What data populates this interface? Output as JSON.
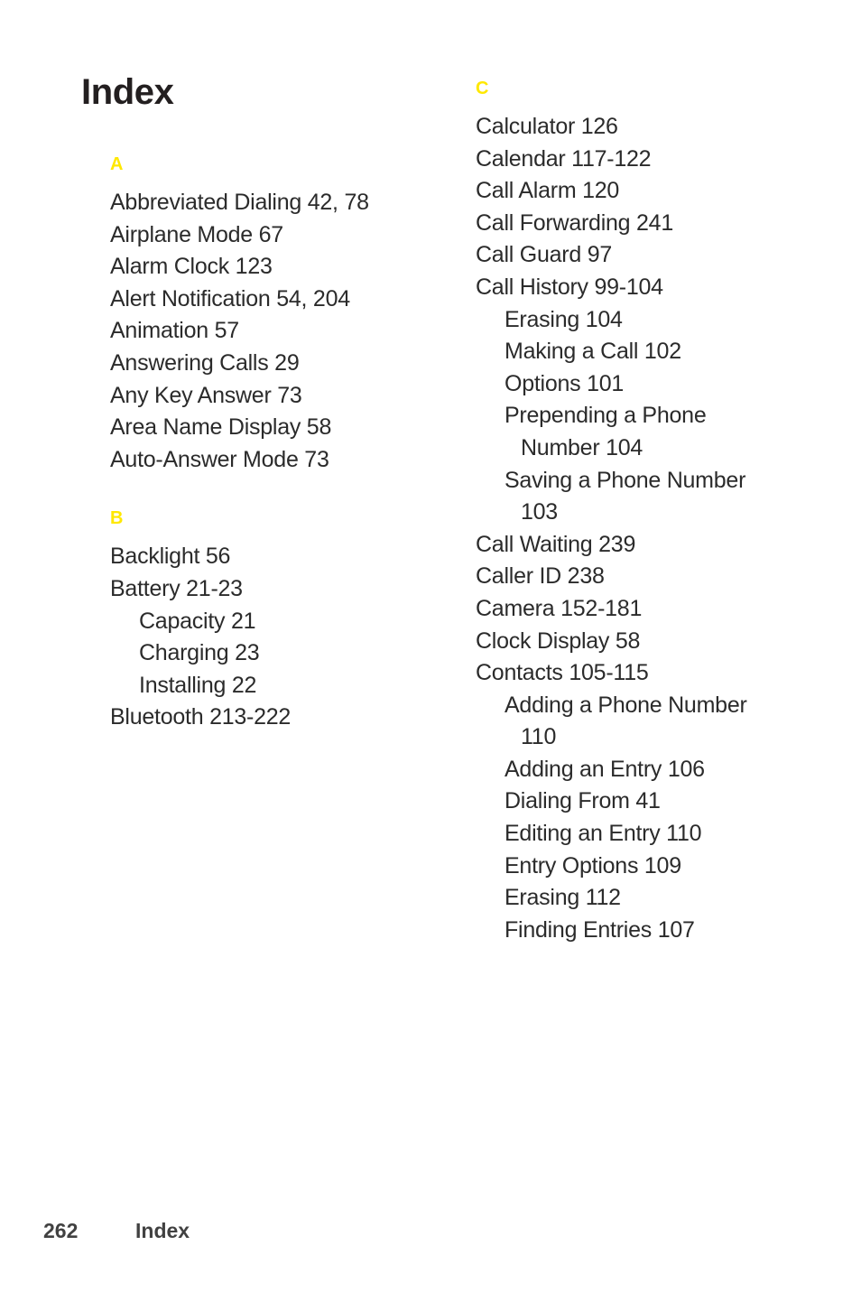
{
  "page": {
    "title": "Index",
    "background_color": "#ffffff",
    "letter_heading_color": "#ffe800",
    "body_text_color": "#2b2b2b",
    "title_color": "#231f20"
  },
  "columns": {
    "left": {
      "sections": [
        {
          "letter": "A",
          "entries": [
            {
              "text": "Abbreviated Dialing 42, 78",
              "level": "main"
            },
            {
              "text": "Airplane Mode 67",
              "level": "main"
            },
            {
              "text": "Alarm Clock 123",
              "level": "main"
            },
            {
              "text": "Alert Notification 54, 204",
              "level": "main"
            },
            {
              "text": "Animation 57",
              "level": "main"
            },
            {
              "text": "Answering Calls 29",
              "level": "main"
            },
            {
              "text": "Any Key Answer 73",
              "level": "main"
            },
            {
              "text": "Area Name Display 58",
              "level": "main"
            },
            {
              "text": "Auto-Answer Mode 73",
              "level": "main"
            }
          ]
        },
        {
          "letter": "B",
          "entries": [
            {
              "text": "Backlight 56",
              "level": "main"
            },
            {
              "text": "Battery 21-23",
              "level": "main"
            },
            {
              "text": "Capacity 21",
              "level": "sub"
            },
            {
              "text": "Charging 23",
              "level": "sub"
            },
            {
              "text": "Installing 22",
              "level": "sub"
            },
            {
              "text": "Bluetooth 213-222",
              "level": "main"
            }
          ]
        }
      ]
    },
    "right": {
      "sections": [
        {
          "letter": "C",
          "entries": [
            {
              "text": "Calculator 126",
              "level": "main"
            },
            {
              "text": "Calendar 117-122",
              "level": "main"
            },
            {
              "text": "Call Alarm 120",
              "level": "main"
            },
            {
              "text": "Call Forwarding 241",
              "level": "main"
            },
            {
              "text": "Call Guard 97",
              "level": "main"
            },
            {
              "text": "Call History 99-104",
              "level": "main"
            },
            {
              "text": "Erasing 104",
              "level": "sub"
            },
            {
              "text": "Making a Call 102",
              "level": "sub"
            },
            {
              "text": "Options 101",
              "level": "sub"
            },
            {
              "text": "Prepending a Phone Number 104",
              "level": "sub-wrap"
            },
            {
              "text": "Saving a Phone Number 103",
              "level": "sub-wrap"
            },
            {
              "text": "Call Waiting 239",
              "level": "main"
            },
            {
              "text": "Caller ID 238",
              "level": "main"
            },
            {
              "text": "Camera 152-181",
              "level": "main"
            },
            {
              "text": "Clock Display 58",
              "level": "main"
            },
            {
              "text": "Contacts 105-115",
              "level": "main"
            },
            {
              "text": "Adding a Phone Number 110",
              "level": "sub-wrap"
            },
            {
              "text": "Adding an Entry 106",
              "level": "sub"
            },
            {
              "text": "Dialing From 41",
              "level": "sub"
            },
            {
              "text": "Editing an Entry 110",
              "level": "sub"
            },
            {
              "text": "Entry Options 109",
              "level": "sub"
            },
            {
              "text": "Erasing 112",
              "level": "sub"
            },
            {
              "text": "Finding Entries 107",
              "level": "sub"
            }
          ]
        }
      ]
    }
  },
  "footer": {
    "page_number": "262",
    "label": "Index"
  }
}
